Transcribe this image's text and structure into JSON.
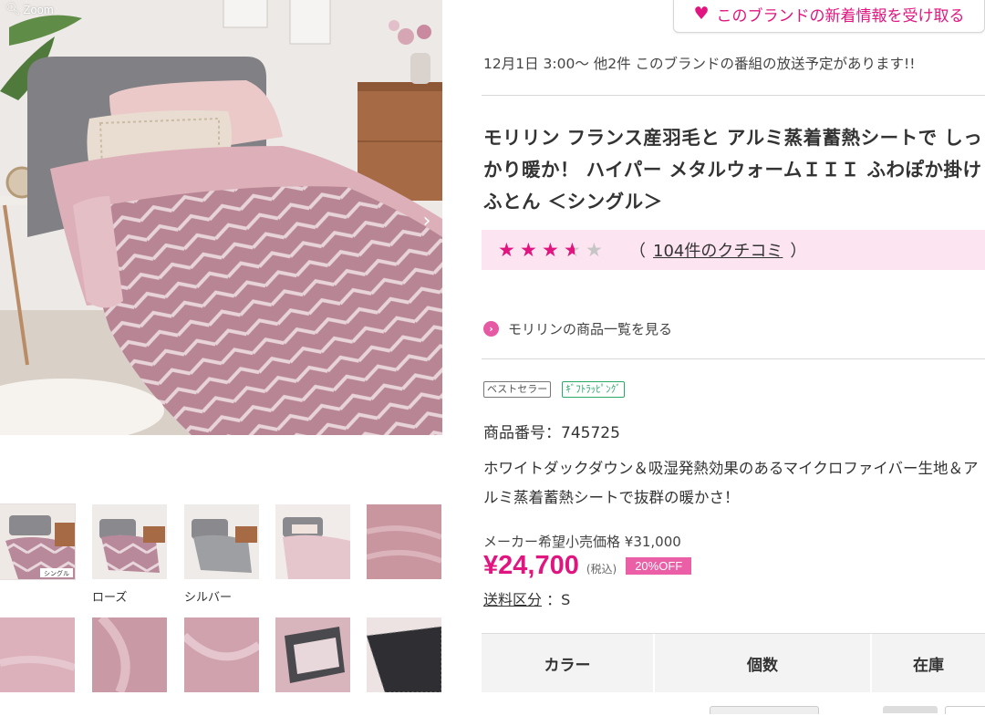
{
  "gallery": {
    "zoom_label": "Zoom",
    "next_arrow": "›",
    "thumb_captions": [
      "ローズ",
      "シルバー"
    ],
    "thumb_tag": "シングル"
  },
  "brand_button": {
    "icon": "heart-icon",
    "label": "このブランドの新着情報を受け取る",
    "color": "#e0157f"
  },
  "broadcast_notice": "12月1日 3:00〜 他2件 このブランドの番組の放送予定があります!!",
  "product": {
    "title": "モリリン フランス産羽毛と アルミ蒸着蓄熱シートで しっかり暖か！ ハイパー メタルウォームＩＩＩ ふわぽか掛けふとん ＜シングル＞",
    "rating": 3.5,
    "rating_max": 5,
    "review_open": "（",
    "review_link": "104件のクチコミ",
    "review_close": "）",
    "brand_list_link": "モリリンの商品一覧を見る",
    "badges": [
      "ベストセラー",
      "ｷﾞﾌﾄﾗｯﾋﾟﾝｸﾞ"
    ],
    "product_number": "商品番号：745725",
    "description": "ホワイトダックダウン＆吸湿発熱効果のあるマイクロファイバー生地＆アルミ蒸着蓄熱シートで抜群の暖かさ！",
    "msrp": "メーカー希望小売価格 ¥31,000",
    "price": "¥24,700",
    "tax_note": "(税込)",
    "discount": "20%OFF",
    "shipping_label": "送料区分",
    "shipping_value": "：S"
  },
  "spec_table": {
    "headers": [
      "カラー",
      "個数",
      "在庫"
    ]
  },
  "colors": {
    "accent": "#e0157f",
    "rating_bg": "#fce4f0",
    "off_badge": "#ea5fa5"
  }
}
